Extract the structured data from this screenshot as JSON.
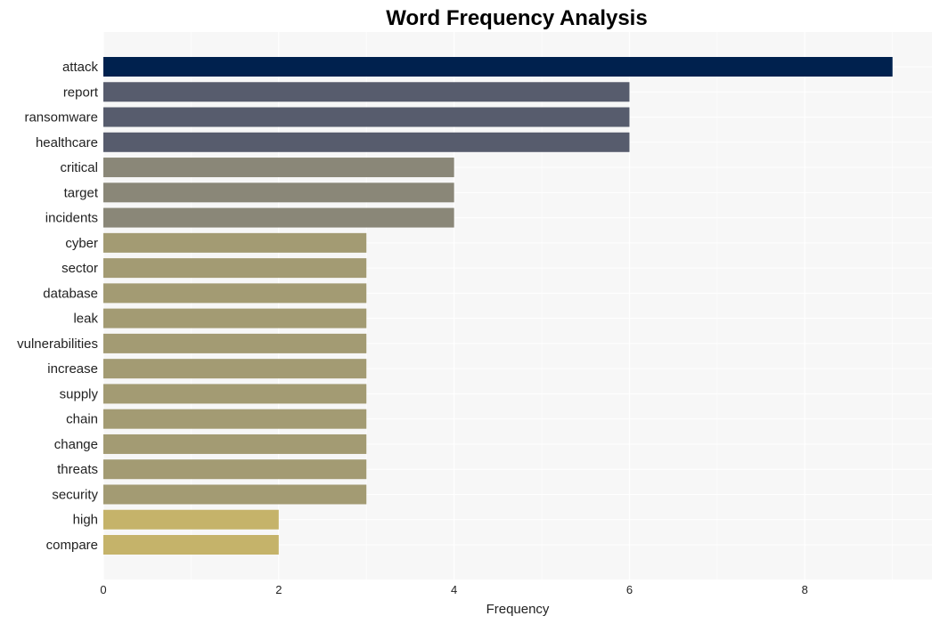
{
  "chart_data": {
    "type": "bar",
    "orientation": "horizontal",
    "title": "Word Frequency Analysis",
    "xlabel": "Frequency",
    "ylabel": "",
    "xlim": [
      0,
      9.45
    ],
    "xticks": [
      0,
      2,
      4,
      6,
      8
    ],
    "grid": true,
    "legend": "none",
    "categories": [
      "attack",
      "report",
      "ransomware",
      "healthcare",
      "critical",
      "target",
      "incidents",
      "cyber",
      "sector",
      "database",
      "leak",
      "vulnerabilities",
      "increase",
      "supply",
      "chain",
      "change",
      "threats",
      "security",
      "high",
      "compare"
    ],
    "values": [
      9,
      6,
      6,
      6,
      4,
      4,
      4,
      3,
      3,
      3,
      3,
      3,
      3,
      3,
      3,
      3,
      3,
      3,
      2,
      2
    ],
    "colors_by_value": {
      "9": "#00214e",
      "6": "#575c6d",
      "4": "#8a8778",
      "3": "#a39b73",
      "2": "#c5b36a"
    },
    "plot_background": "#f7f7f7",
    "grid_color": "#ffffff"
  }
}
